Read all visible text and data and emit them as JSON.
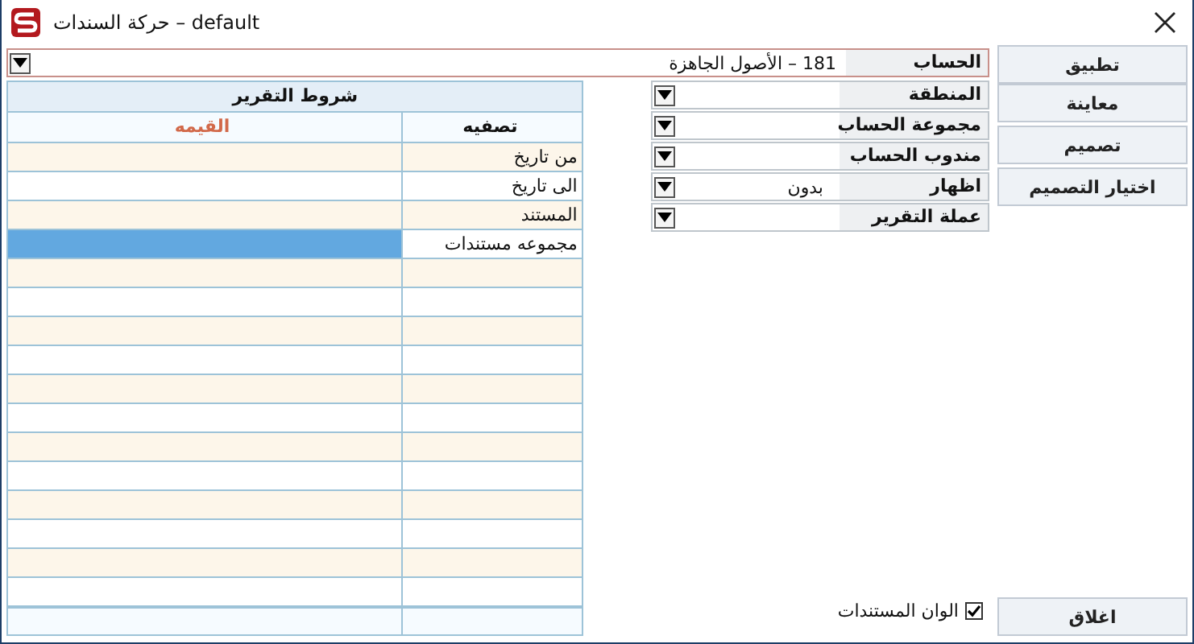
{
  "window": {
    "title": "حركة السندات – default"
  },
  "account": {
    "label": "الحساب",
    "value": "181 – الأصول الجاهزة"
  },
  "conditions": {
    "title": "شروط التقرير",
    "columns": [
      "تصفيه",
      "القيمه"
    ],
    "rows": [
      {
        "filter": "من تاريخ",
        "selected": false
      },
      {
        "filter": "الى تاريخ",
        "selected": false
      },
      {
        "filter": "المستند",
        "selected": false
      },
      {
        "filter": "مجموعه مستندات",
        "selected": true
      }
    ]
  },
  "combos": [
    {
      "label": "المنطقة"
    },
    {
      "label": "مجموعة الحساب"
    },
    {
      "label": "مندوب الحساب"
    },
    {
      "label": "اظهار",
      "value": "بدون"
    },
    {
      "label": "عملة التقرير"
    }
  ],
  "buttons": [
    "تطبيق",
    "معاينة",
    "تصميم",
    "اختيار التصميم"
  ],
  "document_colors": {
    "label": "الوان المستندات",
    "checked": true
  },
  "close_button": "اغلاق"
}
